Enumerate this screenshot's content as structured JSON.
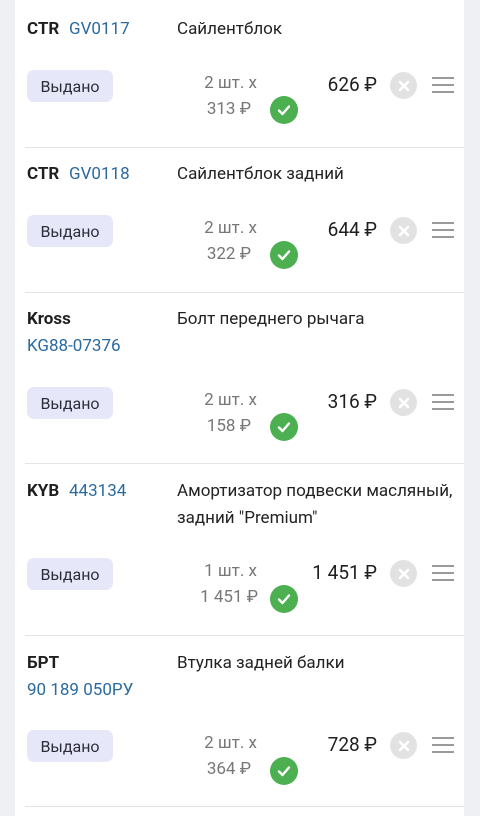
{
  "items": [
    {
      "brand": "CTR",
      "article": "GV0117",
      "name": "Сайлентблок",
      "status": "Выдано",
      "qty": "2 шт. х",
      "unit_price": "313 ₽",
      "total": "626 ₽"
    },
    {
      "brand": "CTR",
      "article": "GV0118",
      "name": "Сайлентблок задний",
      "status": "Выдано",
      "qty": "2 шт. х",
      "unit_price": "322 ₽",
      "total": "644 ₽"
    },
    {
      "brand": "Kross",
      "article": "KG88-07376",
      "name": "Болт переднего рычага",
      "status": "Выдано",
      "qty": "2 шт. х",
      "unit_price": "158 ₽",
      "total": "316 ₽"
    },
    {
      "brand": "KYB",
      "article": "443134",
      "name": "Амортизатор подвески масляный, задний \"Premium\"",
      "status": "Выдано",
      "qty": "1 шт. х",
      "unit_price": "1 451 ₽",
      "total": "1 451 ₽"
    },
    {
      "brand": "БРТ",
      "article": "90 189 050РУ",
      "name": "Втулка задней балки",
      "status": "Выдано",
      "qty": "2 шт. х",
      "unit_price": "364 ₽",
      "total": "728 ₽"
    }
  ],
  "colors": {
    "status_badge": "#e6e7f9",
    "check": "#4caf50",
    "article_link": "#2b6a9e"
  },
  "icons": {
    "check": "check-circle-icon",
    "delete": "close-circle-icon",
    "menu": "hamburger-menu-icon"
  }
}
